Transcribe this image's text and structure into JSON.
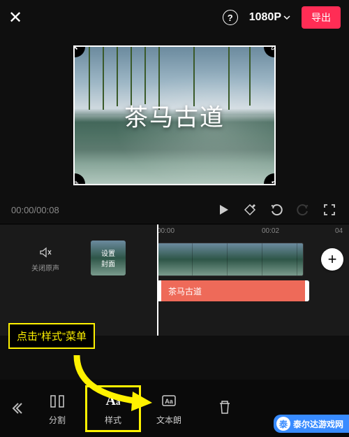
{
  "header": {
    "resolution": "1080P",
    "export_label": "导出"
  },
  "preview": {
    "title_text": "茶马古道"
  },
  "playbar": {
    "time_current": "00:00",
    "time_total": "00:08"
  },
  "ruler": {
    "t0": "00:00",
    "t1": "00:02",
    "t2": "04"
  },
  "tracks": {
    "mute_label": "关闭原声",
    "cover_label": "设置\n封面",
    "text_clip_label": "茶马古道"
  },
  "tutorial": {
    "hint": "点击“样式”菜单"
  },
  "toolbar": {
    "split": "分割",
    "style": "样式",
    "tts": "文本朗",
    "delete_icon": "trash"
  },
  "watermark": {
    "text": "泰尔达游戏网"
  }
}
